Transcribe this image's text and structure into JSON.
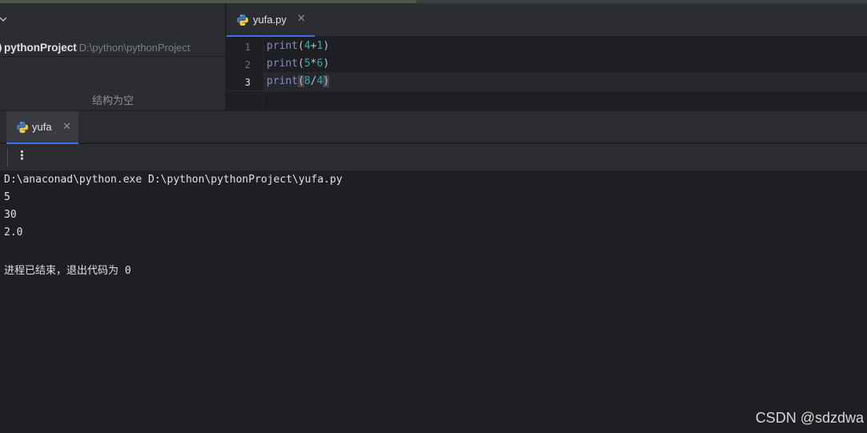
{
  "project_panel": {
    "project_name": "pythonProject",
    "project_path": "D:\\python\\pythonProject",
    "structure_empty": "结构为空"
  },
  "editor": {
    "tab_label": "yufa.py",
    "lines": [
      {
        "number": "1",
        "fn": "print",
        "open": "(",
        "a": "4",
        "op": "+",
        "b": "1",
        "close": ")"
      },
      {
        "number": "2",
        "fn": "print",
        "open": "(",
        "a": "5",
        "op": "*",
        "b": "6",
        "close": ")"
      },
      {
        "number": "3",
        "fn": "print",
        "open": "(",
        "a": "8",
        "op": "/",
        "b": "4",
        "close": ")"
      }
    ]
  },
  "run": {
    "tab_label": "yufa",
    "console": [
      "D:\\anaconad\\python.exe D:\\python\\pythonProject\\yufa.py",
      "5",
      "30",
      "2.0",
      "",
      "进程已结束，退出代码为 0"
    ]
  },
  "watermark": "CSDN @sdzdwa",
  "icons": {
    "file_icon": "python-icon",
    "close": "close-icon",
    "more": "more-vertical-icon",
    "collapse": "chevron-down-icon"
  },
  "colors": {
    "accent": "#3574f0",
    "background": "#1e1f22",
    "panel": "#2b2d30"
  }
}
